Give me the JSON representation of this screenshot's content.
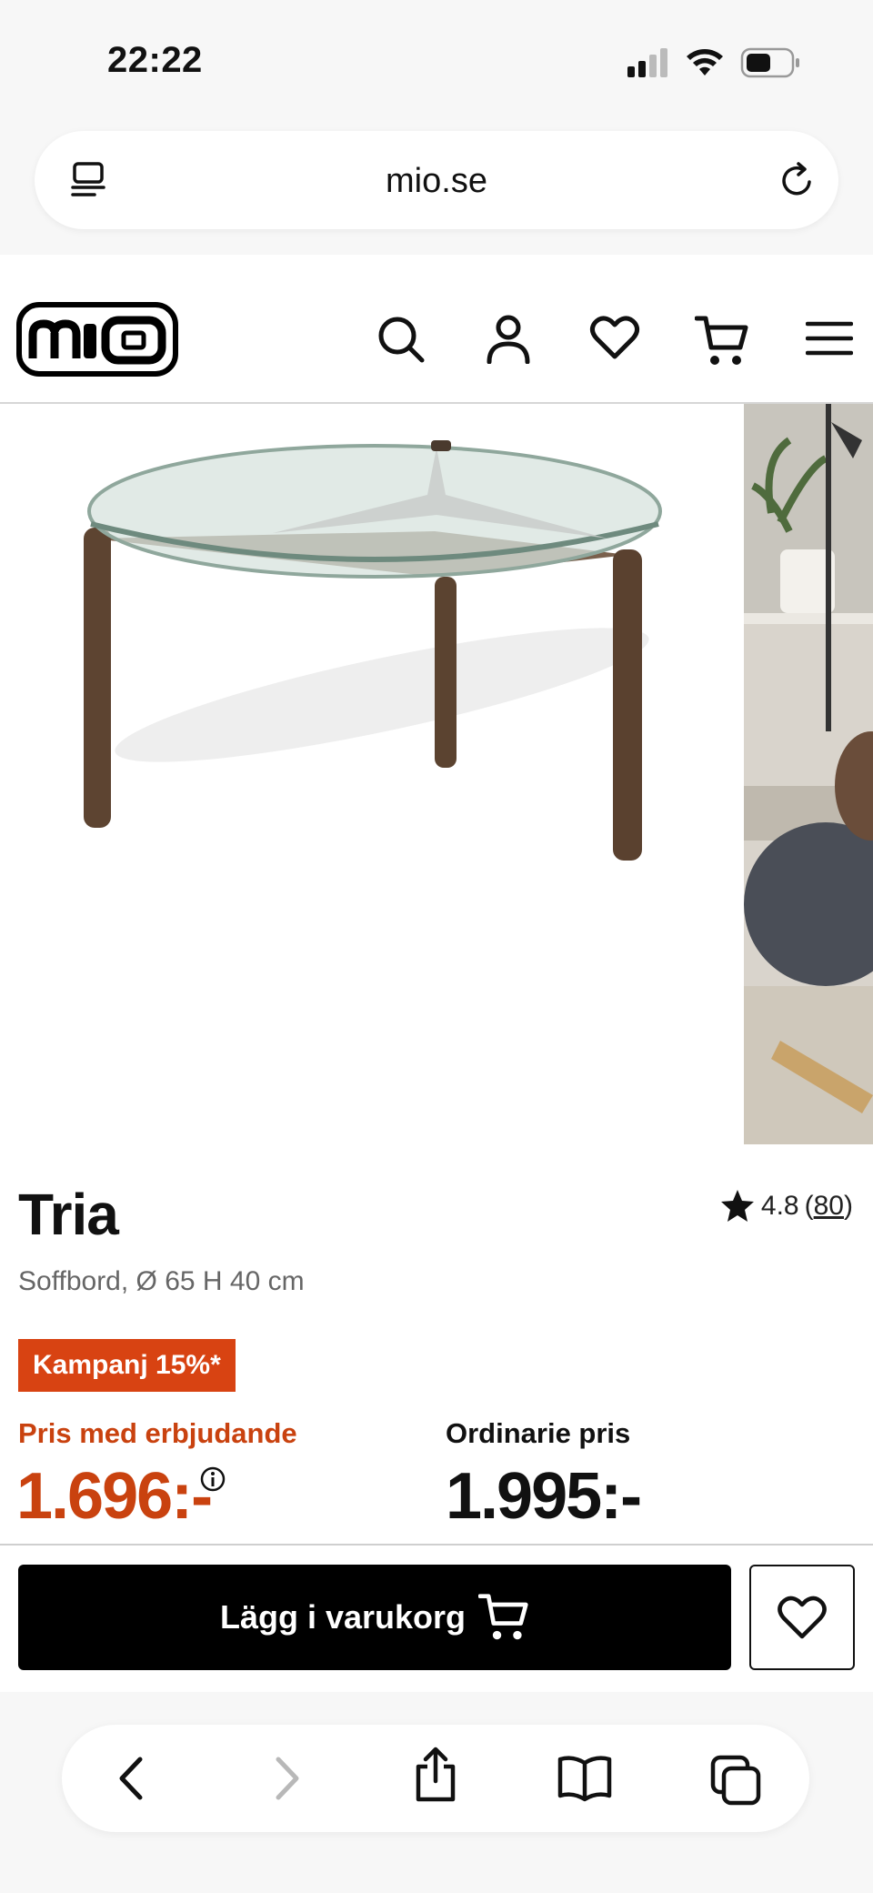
{
  "status_bar": {
    "time": "22:22"
  },
  "browser": {
    "url": "mio.se"
  },
  "product": {
    "title": "Tria",
    "rating": "4.8",
    "rating_count": "80",
    "subtitle": "Soffbord, Ø 65 H 40 cm",
    "campaign_badge": "Kampanj 15%*",
    "offer_label": "Pris med erbjudande",
    "offer_price": "1.696:-",
    "regular_label": "Ordinarie pris",
    "regular_price": "1.995:-"
  },
  "actions": {
    "add_to_cart": "Lägg i varukorg"
  },
  "colors": {
    "accent": "#d84312",
    "button": "#000000"
  },
  "icons": [
    "reader-icon",
    "reload-icon",
    "search-icon",
    "account-icon",
    "heart-icon",
    "cart-icon",
    "menu-icon",
    "star-icon",
    "info-icon",
    "back-icon",
    "forward-icon",
    "share-icon",
    "bookmarks-icon",
    "tabs-icon"
  ]
}
